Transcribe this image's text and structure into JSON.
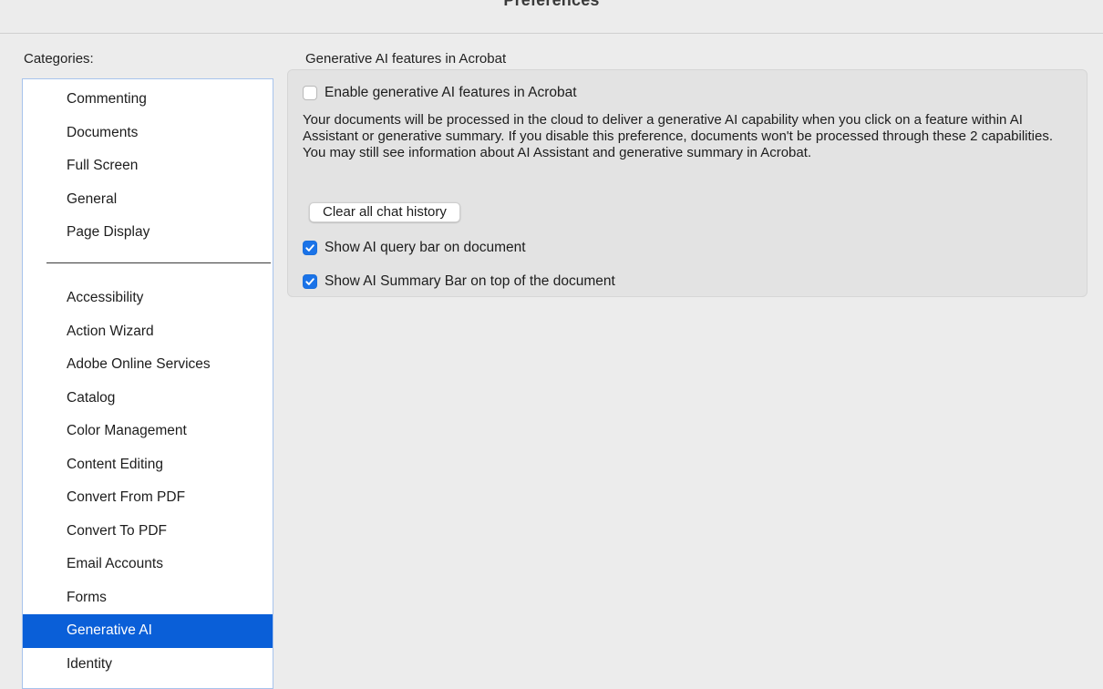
{
  "window": {
    "title": "Preferences"
  },
  "sidebar": {
    "label": "Categories:",
    "top_items": [
      {
        "label": "Commenting"
      },
      {
        "label": "Documents"
      },
      {
        "label": "Full Screen"
      },
      {
        "label": "General"
      },
      {
        "label": "Page Display"
      }
    ],
    "bottom_items": [
      {
        "label": "Accessibility"
      },
      {
        "label": "Action Wizard"
      },
      {
        "label": "Adobe Online Services"
      },
      {
        "label": "Catalog"
      },
      {
        "label": "Color Management"
      },
      {
        "label": "Content Editing"
      },
      {
        "label": "Convert From PDF"
      },
      {
        "label": "Convert To PDF"
      },
      {
        "label": "Email Accounts"
      },
      {
        "label": "Forms"
      },
      {
        "label": "Generative AI",
        "selected": true
      },
      {
        "label": "Identity"
      }
    ]
  },
  "panel": {
    "section_title": "Generative AI features in Acrobat",
    "enable_checkbox": {
      "label": "Enable generative AI features in Acrobat",
      "checked": false
    },
    "description": "Your documents will be processed in the cloud to deliver a generative AI capability when you click on a feature within AI Assistant or generative summary. If you disable this preference, documents won't be processed through these 2 capabilities. You may still see information about AI Assistant and generative summary in Acrobat.",
    "clear_button_label": "Clear all chat history",
    "query_bar_checkbox": {
      "label": "Show AI query bar on document",
      "checked": true
    },
    "summary_bar_checkbox": {
      "label": "Show AI Summary Bar on top of the document",
      "checked": true
    }
  },
  "colors": {
    "selection": "#0a5fd8",
    "checkbox_checked": "#1a73e8",
    "window_background": "#ececec",
    "group_background": "#e3e3e3"
  },
  "icons": {
    "checkmark": "checkmark-icon"
  }
}
